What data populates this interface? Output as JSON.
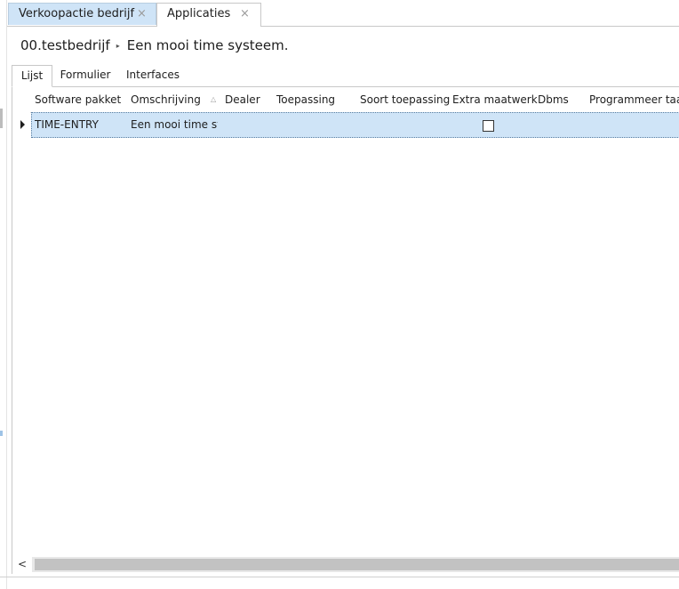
{
  "tabs": [
    {
      "label": "Verkoopactie bedrijf",
      "active": false
    },
    {
      "label": "Applicaties",
      "active": true
    }
  ],
  "close_glyph": "×",
  "breadcrumb": {
    "parent": "00.testbedrijf",
    "separator": "▸",
    "current": "Een mooi time systeem."
  },
  "sub_tabs": [
    "Lijst",
    "Formulier",
    "Interfaces"
  ],
  "grid": {
    "columns": [
      "Software pakket",
      "Omschrijving",
      "Dealer",
      "Toepassing",
      "Soort toepassing",
      "Extra maatwerk",
      "Dbms",
      "Programmeer taal"
    ],
    "sort_glyph": "△",
    "rows": [
      {
        "software_pakket": "TIME-ENTRY",
        "omschrijving": "Een mooi time sys",
        "dealer": "",
        "toepassing": "",
        "soort_toepassing": "",
        "extra_maatwerk": false,
        "dbms": "",
        "programmeer_taal": ""
      }
    ]
  },
  "scrollbar": {
    "left_glyph": "<"
  },
  "colors": {
    "accent": "#cfe4f7",
    "border": "#c8c8c8"
  }
}
